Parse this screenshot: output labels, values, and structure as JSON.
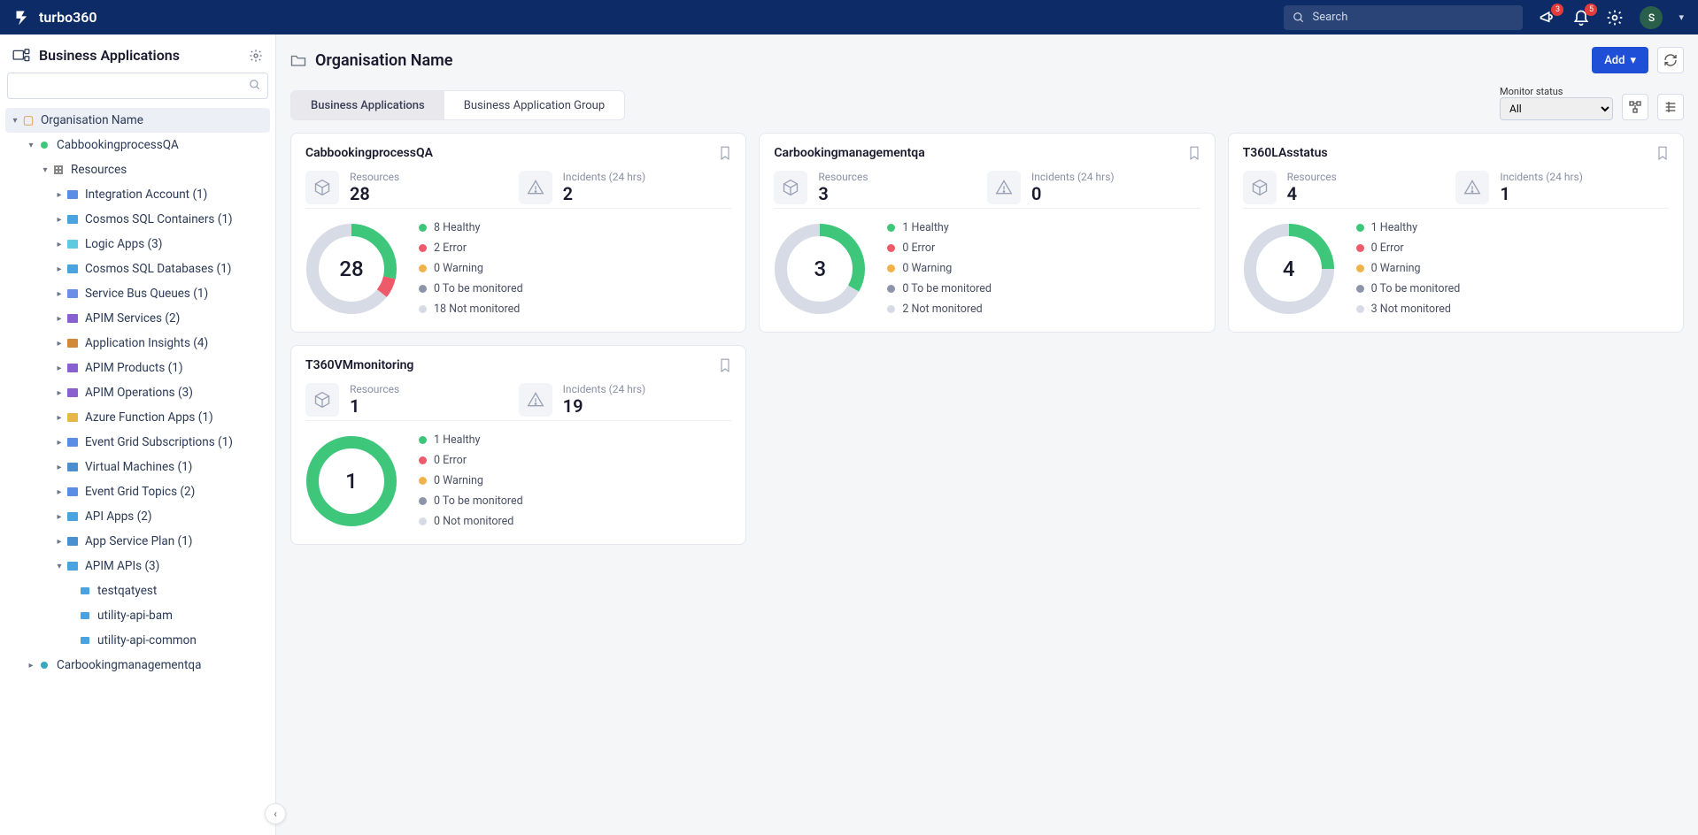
{
  "brand": "turbo360",
  "search_placeholder": "Search",
  "badges": {
    "announcements": "3",
    "notifications": "5"
  },
  "user_initial": "S",
  "sidebar": {
    "title": "Business Applications",
    "org": "Organisation Name",
    "app": "CabbookingprocessQA",
    "resources_label": "Resources",
    "items": [
      "Integration Account (1)",
      "Cosmos SQL Containers (1)",
      "Logic Apps (3)",
      "Cosmos SQL Databases (1)",
      "Service Bus Queues (1)",
      "APIM Services (2)",
      "Application Insights (4)",
      "APIM Products (1)",
      "APIM Operations (3)",
      "Azure Function Apps (1)",
      "Event Grid Subscriptions (1)",
      "Virtual Machines (1)",
      "Event Grid Topics (2)",
      "API Apps (2)",
      "App Service Plan (1)"
    ],
    "apim_apis_label": "APIM APIs (3)",
    "apim_children": [
      "testqatyest",
      "utility-api-bam",
      "utility-api-common"
    ],
    "otherapp": "Carbookingmanagementqa"
  },
  "main": {
    "title": "Organisation Name",
    "add_label": "Add",
    "tabs": {
      "a": "Business Applications",
      "b": "Business Application Group"
    },
    "monitor_label": "Monitor status",
    "monitor_value": "All"
  },
  "chart_data": [
    {
      "title": "CabbookingprocessQA",
      "resources": "28",
      "incidents": "2",
      "type": "donut",
      "series": [
        {
          "name": "Healthy",
          "value": 8,
          "color": "#3ec77a"
        },
        {
          "name": "Error",
          "value": 2,
          "color": "#ef5a6a"
        },
        {
          "name": "Warning",
          "value": 0,
          "color": "#f2b24a"
        },
        {
          "name": "To be monitored",
          "value": 0,
          "color": "#8e95ab"
        },
        {
          "name": "Not monitored",
          "value": 18,
          "color": "#d7dbe5"
        }
      ]
    },
    {
      "title": "Carbookingmanagementqa",
      "resources": "3",
      "incidents": "0",
      "type": "donut",
      "series": [
        {
          "name": "Healthy",
          "value": 1,
          "color": "#3ec77a"
        },
        {
          "name": "Error",
          "value": 0,
          "color": "#ef5a6a"
        },
        {
          "name": "Warning",
          "value": 0,
          "color": "#f2b24a"
        },
        {
          "name": "To be monitored",
          "value": 0,
          "color": "#8e95ab"
        },
        {
          "name": "Not monitored",
          "value": 2,
          "color": "#d7dbe5"
        }
      ]
    },
    {
      "title": "T360LAsstatus",
      "resources": "4",
      "incidents": "1",
      "type": "donut",
      "series": [
        {
          "name": "Healthy",
          "value": 1,
          "color": "#3ec77a"
        },
        {
          "name": "Error",
          "value": 0,
          "color": "#ef5a6a"
        },
        {
          "name": "Warning",
          "value": 0,
          "color": "#f2b24a"
        },
        {
          "name": "To be monitored",
          "value": 0,
          "color": "#8e95ab"
        },
        {
          "name": "Not monitored",
          "value": 3,
          "color": "#d7dbe5"
        }
      ]
    },
    {
      "title": "T360VMmonitoring",
      "resources": "1",
      "incidents": "19",
      "type": "donut",
      "series": [
        {
          "name": "Healthy",
          "value": 1,
          "color": "#3ec77a"
        },
        {
          "name": "Error",
          "value": 0,
          "color": "#ef5a6a"
        },
        {
          "name": "Warning",
          "value": 0,
          "color": "#f2b24a"
        },
        {
          "name": "To be monitored",
          "value": 0,
          "color": "#8e95ab"
        },
        {
          "name": "Not monitored",
          "value": 0,
          "color": "#d7dbe5"
        }
      ]
    }
  ],
  "stat_labels": {
    "resources": "Resources",
    "incidents": "Incidents (24 hrs)"
  }
}
